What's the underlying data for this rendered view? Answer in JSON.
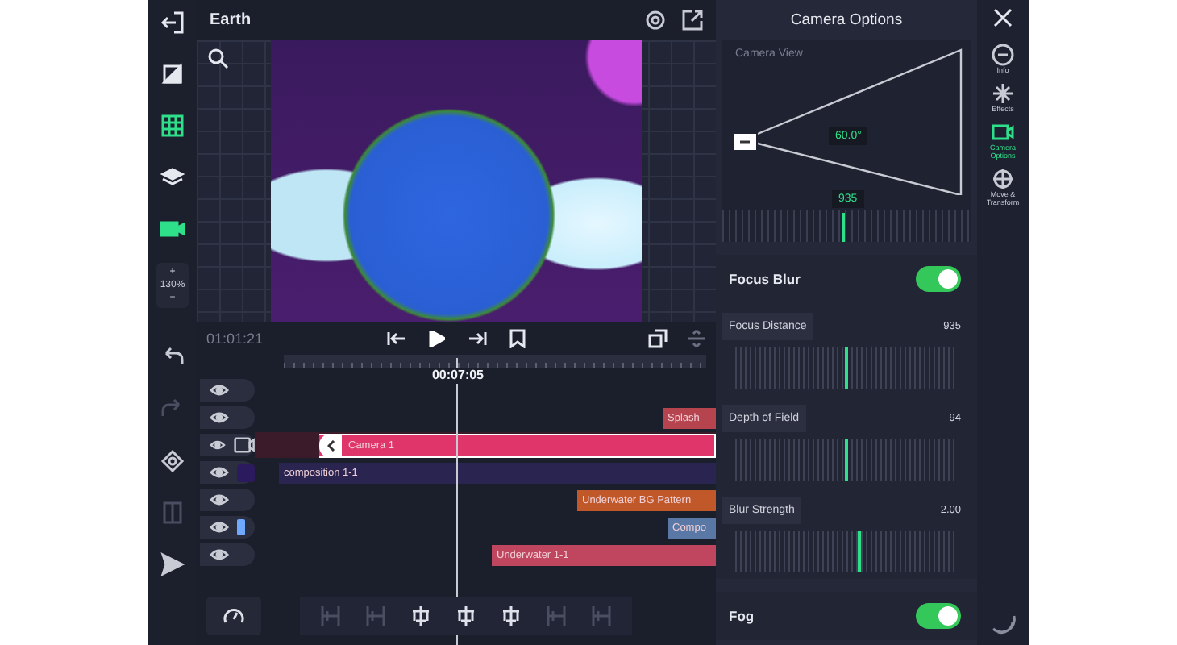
{
  "window": {
    "title": "Earth"
  },
  "left_tools": [
    {
      "kind": "exit",
      "selected": false
    },
    {
      "kind": "crop",
      "selected": false
    },
    {
      "kind": "grid",
      "selected": true
    },
    {
      "kind": "layer",
      "selected": false
    },
    {
      "kind": "camera",
      "selected": true
    }
  ],
  "zoom": {
    "plus": "+",
    "percent": "130%",
    "minus": "−"
  },
  "edit_tools": [
    {
      "kind": "undo",
      "disabled": false
    },
    {
      "kind": "redo",
      "disabled": true
    },
    {
      "kind": "keyframe",
      "disabled": false
    },
    {
      "kind": "split",
      "disabled": true
    },
    {
      "kind": "send",
      "disabled": false
    }
  ],
  "timecode": "01:01:21",
  "playhead_time": "00:07:05",
  "tracks": [
    {
      "kind": "partial"
    },
    {
      "kind": "plain",
      "clip": {
        "label": "Splash",
        "color": "#b5444f",
        "selected": false
      }
    },
    {
      "kind": "camera",
      "clip": {
        "label": "Camera 1",
        "color": "#e0356a",
        "selected": true
      }
    },
    {
      "kind": "composition",
      "clip": {
        "label": "composition 1-1",
        "color": "#2a2550",
        "selected": false
      }
    },
    {
      "kind": "plain",
      "clip": {
        "label": "Underwater BG Pattern",
        "color": "#c0582a",
        "selected": false
      }
    },
    {
      "kind": "image",
      "clip": {
        "label": "Compo",
        "color": "#5a78a5",
        "selected": false
      }
    },
    {
      "kind": "plain",
      "clip": {
        "label": "Underwater 1-1",
        "color": "#c0455e",
        "selected": false
      }
    }
  ],
  "align_tools": [
    {
      "kind": "edge",
      "disabled": true
    },
    {
      "kind": "edge",
      "disabled": true
    },
    {
      "kind": "center",
      "disabled": false
    },
    {
      "kind": "center",
      "disabled": false
    },
    {
      "kind": "center",
      "disabled": false
    },
    {
      "kind": "edge",
      "disabled": true
    },
    {
      "kind": "edge",
      "disabled": true
    }
  ],
  "panel": {
    "title": "Camera Options",
    "camera_view": {
      "label": "Camera View",
      "angle": "60.0°",
      "distance": "935"
    },
    "sections": [
      {
        "kind": "toggle",
        "label": "Focus Blur",
        "on": true
      },
      {
        "kind": "slider",
        "label": "Focus Distance",
        "reading": "935",
        "level": 0.5
      },
      {
        "kind": "slider",
        "label": "Depth of Field",
        "reading": "94",
        "level": 0.5
      },
      {
        "kind": "slider",
        "label": "Blur Strength",
        "reading": "2.00",
        "level": 0.56
      },
      {
        "kind": "toggle",
        "label": "Fog",
        "on": true
      }
    ]
  },
  "rail": [
    {
      "kind": "info",
      "label": "Info",
      "selected": false
    },
    {
      "kind": "effects",
      "label": "Effects",
      "selected": false
    },
    {
      "kind": "camera",
      "label": "Camera Options",
      "selected": true
    },
    {
      "kind": "move",
      "label": "Move & Transform",
      "selected": false
    }
  ]
}
